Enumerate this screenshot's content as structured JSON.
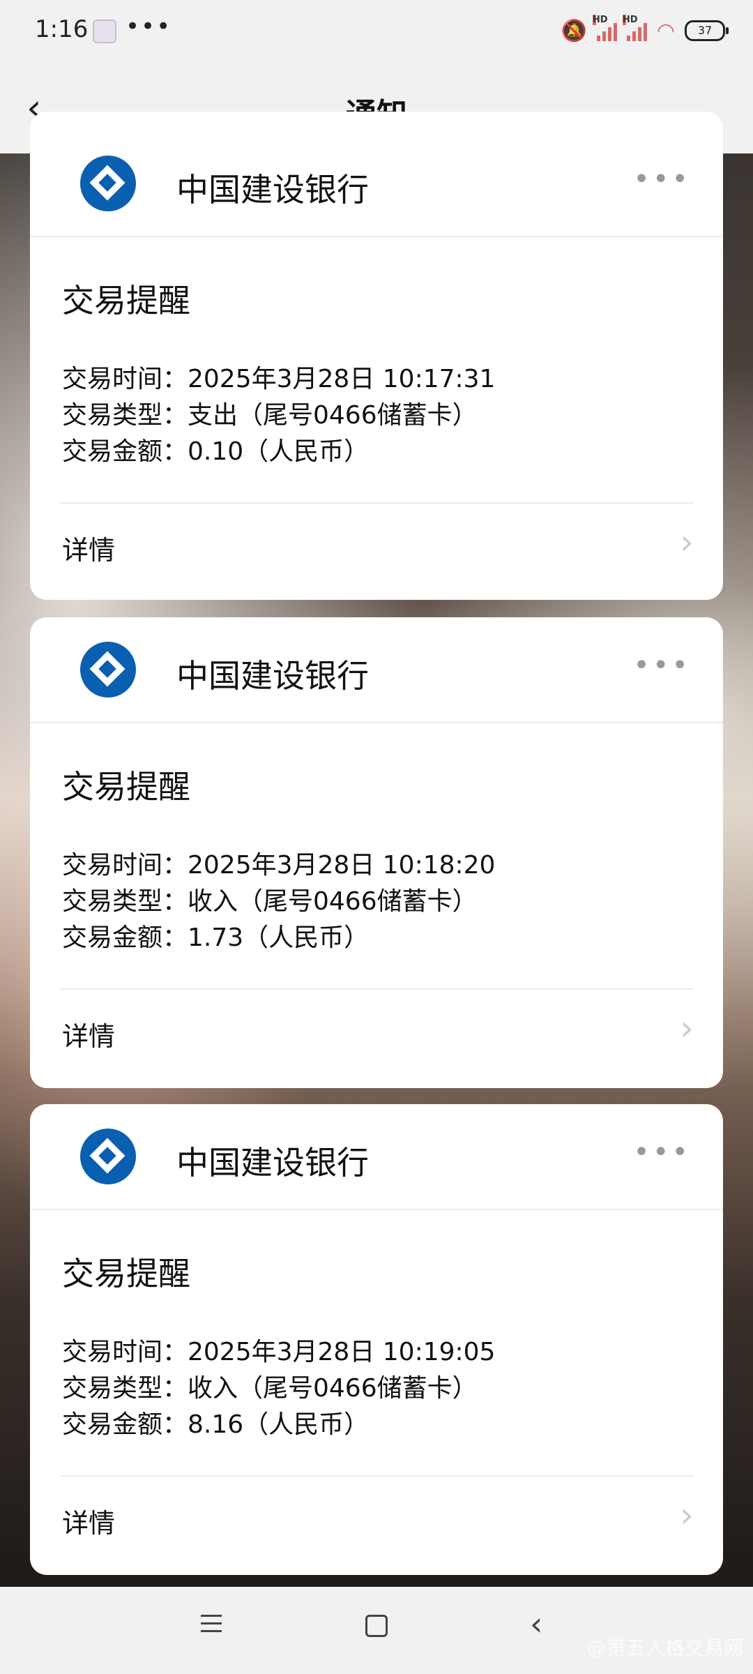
{
  "status_bar": {
    "time": "1:16",
    "dots": "•••",
    "hd1": "HD",
    "hd2": "HD",
    "battery": "37"
  },
  "header": {
    "back_icon": "‹",
    "title": "通知"
  },
  "cards": [
    {
      "bank_name": "中国建设银行",
      "more": "•••",
      "title": "交易提醒",
      "lines": [
        "交易时间：2025年3月28日 10:17:31",
        "交易类型：支出（尾号0466储蓄卡）",
        "交易金额：0.10（人民币）"
      ],
      "detail_label": "详情"
    },
    {
      "bank_name": "中国建设银行",
      "more": "•••",
      "title": "交易提醒",
      "lines": [
        "交易时间：2025年3月28日 10:18:20",
        "交易类型：收入（尾号0466储蓄卡）",
        "交易金额：1.73（人民币）"
      ],
      "detail_label": "详情"
    },
    {
      "bank_name": "中国建设银行",
      "more": "•••",
      "title": "交易提醒",
      "lines": [
        "交易时间：2025年3月28日 10:19:05",
        "交易类型：收入（尾号0466储蓄卡）",
        "交易金额：8.16（人民币）"
      ],
      "detail_label": "详情"
    }
  ],
  "nav": {
    "back": "‹",
    "watermark": "@第五人格交易网"
  },
  "colors": {
    "bank_blue": "#0a5fb0",
    "signal_red": "#dd6666"
  },
  "icons": [
    "bell-muted-icon",
    "signal-icon",
    "wifi-icon",
    "battery-icon",
    "back-arrow-icon",
    "bank-logo-icon",
    "more-icon",
    "chevron-right-icon",
    "menu-icon",
    "home-icon",
    "back-nav-icon"
  ]
}
